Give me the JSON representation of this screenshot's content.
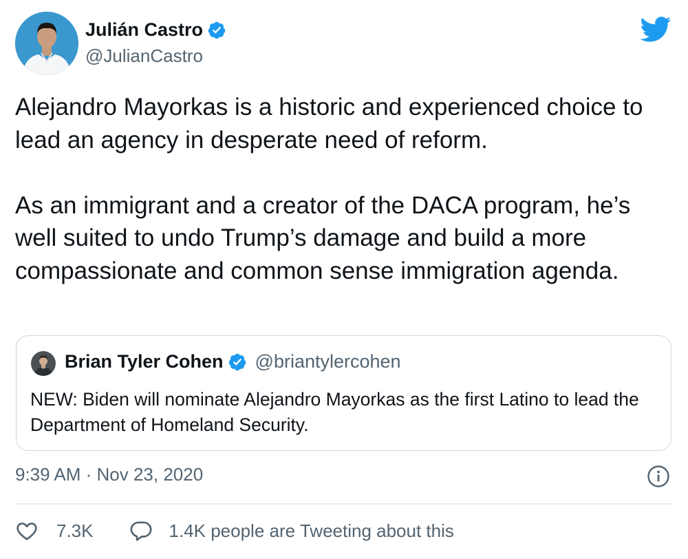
{
  "author": {
    "name": "Julián Castro",
    "handle": "@JulianCastro",
    "verified": true,
    "avatar": "profile-photo"
  },
  "tweet": {
    "paragraphs": [
      "Alejandro Mayorkas is a historic and experienced choice to lead an agency in desperate need of reform.",
      "As an immigrant and a creator of the DACA program, he’s well suited to undo Trump’s damage and build a more compassionate and common sense immigration agenda."
    ],
    "timestamp": "9:39 AM · Nov 23, 2020"
  },
  "quoted_tweet": {
    "name": "Brian Tyler Cohen",
    "handle": "@briantylercohen",
    "verified": true,
    "text": "NEW: Biden will nominate Alejandro Mayorkas as the first Latino to lead the Department of Homeland Security."
  },
  "actions": {
    "likes": "7.3K",
    "conversation": "1.4K people are Tweeting about this"
  },
  "icons": {
    "logo": "twitter-bird-icon",
    "verified": "verified-badge-icon",
    "info": "info-icon",
    "like": "heart-icon",
    "reply": "speech-bubble-icon"
  },
  "colors": {
    "brand": "#1d9bf0",
    "text": "#0f1419",
    "secondary": "#536471",
    "border": "#cfd9de"
  }
}
